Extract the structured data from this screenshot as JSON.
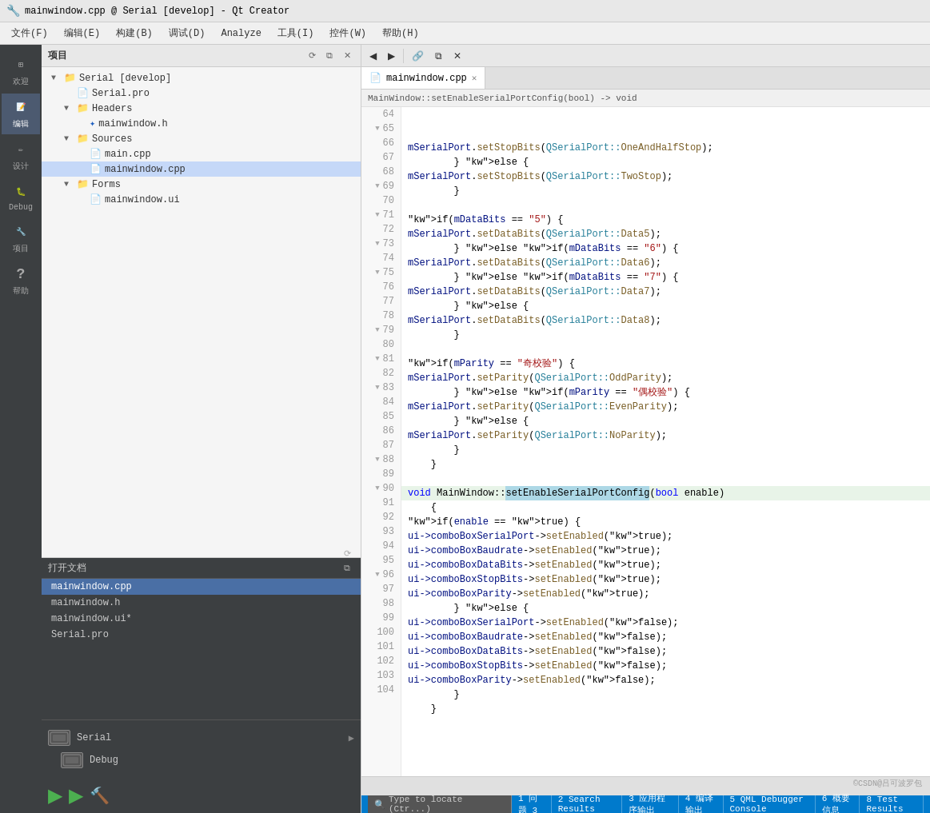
{
  "titlebar": {
    "title": "mainwindow.cpp @ Serial [develop] - Qt Creator"
  },
  "menubar": {
    "items": [
      "文件(F)",
      "编辑(E)",
      "构建(B)",
      "调试(D)",
      "Analyze",
      "工具(I)",
      "控件(W)",
      "帮助(H)"
    ]
  },
  "sidebar": {
    "icons": [
      {
        "id": "welcome",
        "label": "欢迎",
        "symbol": "⊞"
      },
      {
        "id": "edit",
        "label": "编辑",
        "symbol": "📄",
        "active": true
      },
      {
        "id": "design",
        "label": "设计",
        "symbol": "✏"
      },
      {
        "id": "debug",
        "label": "Debug",
        "symbol": "🐛"
      },
      {
        "id": "project",
        "label": "项目",
        "symbol": "🔧"
      },
      {
        "id": "help",
        "label": "帮助",
        "symbol": "?"
      }
    ]
  },
  "project_panel": {
    "title": "项目",
    "tree": [
      {
        "id": "serial-develop",
        "label": "Serial [develop]",
        "indent": 0,
        "type": "root",
        "expanded": true
      },
      {
        "id": "serial-pro",
        "label": "Serial.pro",
        "indent": 1,
        "type": "file"
      },
      {
        "id": "headers",
        "label": "Headers",
        "indent": 1,
        "type": "folder",
        "expanded": true
      },
      {
        "id": "mainwindow-h",
        "label": "mainwindow.h",
        "indent": 2,
        "type": "header"
      },
      {
        "id": "sources",
        "label": "Sources",
        "indent": 1,
        "type": "folder",
        "expanded": true
      },
      {
        "id": "main-cpp",
        "label": "main.cpp",
        "indent": 2,
        "type": "file"
      },
      {
        "id": "mainwindow-cpp",
        "label": "mainwindow.cpp",
        "indent": 2,
        "type": "file",
        "selected": true
      },
      {
        "id": "forms",
        "label": "Forms",
        "indent": 1,
        "type": "folder",
        "expanded": true
      },
      {
        "id": "mainwindow-ui",
        "label": "mainwindow.ui",
        "indent": 2,
        "type": "ui"
      }
    ]
  },
  "open_docs": {
    "title": "打开文档",
    "items": [
      "mainwindow.cpp",
      "mainwindow.h",
      "mainwindow.ui*",
      "Serial.pro"
    ]
  },
  "device_panel": {
    "items": [
      {
        "label": "Serial",
        "type": "device"
      },
      {
        "label": "Debug",
        "type": "debug"
      }
    ]
  },
  "tab_bar": {
    "active_tab": "mainwindow.cpp",
    "tabs": [
      {
        "label": "mainwindow.cpp",
        "active": true
      }
    ]
  },
  "function_bar": {
    "text": "MainWindow::setEnableSerialPortConfig(bool) -> void"
  },
  "code": {
    "lines": [
      {
        "num": 64,
        "fold": false,
        "text": "            mSerialPort.setStopBits(QSerialPort::OneAndHalfStop);"
      },
      {
        "num": 65,
        "fold": true,
        "text": "        } else {"
      },
      {
        "num": 66,
        "fold": false,
        "text": "            mSerialPort.setStopBits(QSerialPort::TwoStop);"
      },
      {
        "num": 67,
        "fold": false,
        "text": "        }"
      },
      {
        "num": 68,
        "fold": false,
        "text": ""
      },
      {
        "num": 69,
        "fold": true,
        "text": "        if(mDataBits == \"5\") {"
      },
      {
        "num": 70,
        "fold": false,
        "text": "            mSerialPort.setDataBits(QSerialPort::Data5);"
      },
      {
        "num": 71,
        "fold": true,
        "text": "        } else if(mDataBits == \"6\") {"
      },
      {
        "num": 72,
        "fold": false,
        "text": "            mSerialPort.setDataBits(QSerialPort::Data6);"
      },
      {
        "num": 73,
        "fold": true,
        "text": "        } else if(mDataBits == \"7\") {"
      },
      {
        "num": 74,
        "fold": false,
        "text": "            mSerialPort.setDataBits(QSerialPort::Data7);"
      },
      {
        "num": 75,
        "fold": true,
        "text": "        } else {"
      },
      {
        "num": 76,
        "fold": false,
        "text": "            mSerialPort.setDataBits(QSerialPort::Data8);"
      },
      {
        "num": 77,
        "fold": false,
        "text": "        }"
      },
      {
        "num": 78,
        "fold": false,
        "text": ""
      },
      {
        "num": 79,
        "fold": true,
        "text": "        if(mParity == \"奇校验\") {"
      },
      {
        "num": 80,
        "fold": false,
        "text": "            mSerialPort.setParity(QSerialPort::OddParity);"
      },
      {
        "num": 81,
        "fold": true,
        "text": "        } else if(mParity == \"偶校验\") {"
      },
      {
        "num": 82,
        "fold": false,
        "text": "            mSerialPort.setParity(QSerialPort::EvenParity);"
      },
      {
        "num": 83,
        "fold": true,
        "text": "        } else {"
      },
      {
        "num": 84,
        "fold": false,
        "text": "            mSerialPort.setParity(QSerialPort::NoParity);"
      },
      {
        "num": 85,
        "fold": false,
        "text": "        }"
      },
      {
        "num": 86,
        "fold": false,
        "text": "    }"
      },
      {
        "num": 87,
        "fold": false,
        "text": ""
      },
      {
        "num": 88,
        "fold": true,
        "text": "    void MainWindow::setEnableSerialPortConfig(bool enable)"
      },
      {
        "num": 89,
        "fold": false,
        "text": "    {"
      },
      {
        "num": 90,
        "fold": true,
        "text": "        if(enable == true) {"
      },
      {
        "num": 91,
        "fold": false,
        "text": "            ui->comboBoxSerialPort->setEnabled(true);"
      },
      {
        "num": 92,
        "fold": false,
        "text": "            ui->comboBoxBaudrate->setEnabled(true);"
      },
      {
        "num": 93,
        "fold": false,
        "text": "            ui->comboBoxDataBits->setEnabled(true);"
      },
      {
        "num": 94,
        "fold": false,
        "text": "            ui->comboBoxStopBits->setEnabled(true);"
      },
      {
        "num": 95,
        "fold": false,
        "text": "            ui->comboBoxParity->setEnabled(true);"
      },
      {
        "num": 96,
        "fold": true,
        "text": "        } else {"
      },
      {
        "num": 97,
        "fold": false,
        "text": "            ui->comboBoxSerialPort->setEnabled(false);"
      },
      {
        "num": 98,
        "fold": false,
        "text": "            ui->comboBoxBaudrate->setEnabled(false);"
      },
      {
        "num": 99,
        "fold": false,
        "text": "            ui->comboBoxDataBits->setEnabled(false);"
      },
      {
        "num": 100,
        "fold": false,
        "text": "            ui->comboBoxStopBits->setEnabled(false);"
      },
      {
        "num": 101,
        "fold": false,
        "text": "            ui->comboBoxParity->setEnabled(false);"
      },
      {
        "num": 102,
        "fold": false,
        "text": "        }"
      },
      {
        "num": 103,
        "fold": false,
        "text": "    }"
      },
      {
        "num": 104,
        "fold": false,
        "text": ""
      }
    ]
  },
  "bottom_tabs": {
    "items": [
      "1 问题 3",
      "2 Search Results",
      "3 应用程序输出",
      "4 编译输出",
      "5 QML Debugger Console",
      "6 概要信息",
      "8 Test Results"
    ]
  },
  "statusbar": {
    "locate_placeholder": "Type to locate (Ctr...)"
  },
  "watermark": "©CSDN@吕可波罗包"
}
